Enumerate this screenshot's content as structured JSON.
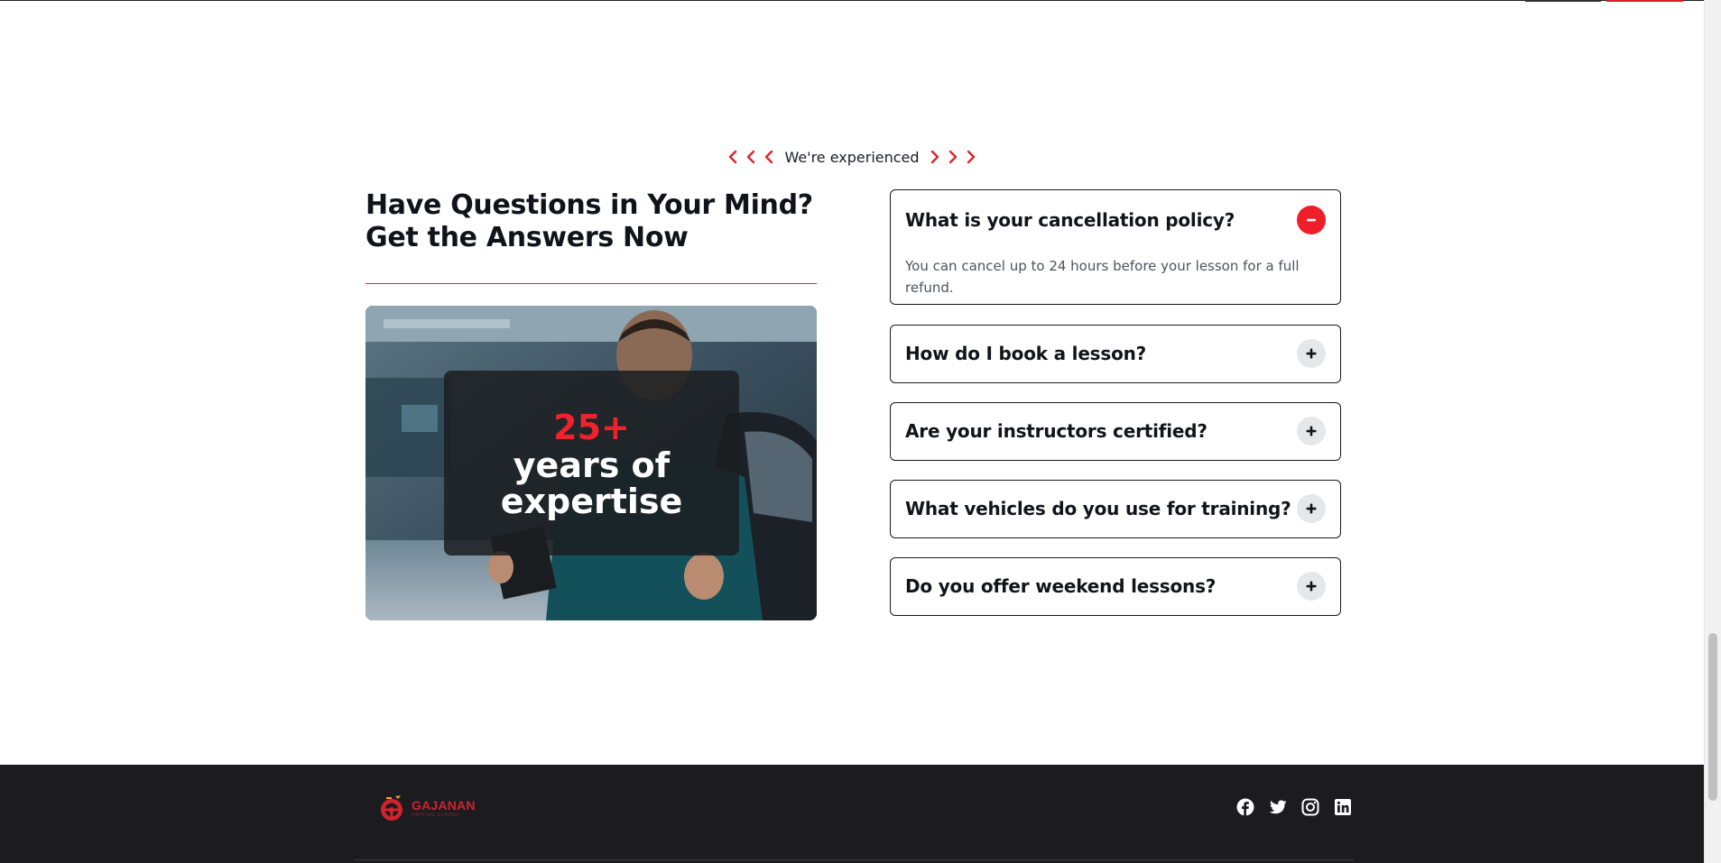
{
  "section": {
    "eyebrow": "We're experienced",
    "heading": "Have Questions in Your Mind? Get the Answers Now"
  },
  "stat": {
    "number": "25+",
    "label": "years of expertise"
  },
  "faq": [
    {
      "question": "What is your cancellation policy?",
      "answer": "You can cancel up to 24 hours before your lesson for a full refund.",
      "expanded": true
    },
    {
      "question": "How do I book a lesson?",
      "expanded": false
    },
    {
      "question": "Are your instructors certified?",
      "expanded": false
    },
    {
      "question": "What vehicles do you use for training?",
      "expanded": false
    },
    {
      "question": "Do you offer weekend lessons?",
      "expanded": false
    }
  ],
  "footer": {
    "logo_name": "GAJANAN",
    "logo_sub": "DRIVING SCHOOL",
    "socials": [
      "facebook-icon",
      "twitter-icon",
      "instagram-icon",
      "linkedin-icon"
    ]
  },
  "colors": {
    "accent": "#ee1f2b",
    "footer_bg": "#1c1b20",
    "text": "#121419"
  }
}
